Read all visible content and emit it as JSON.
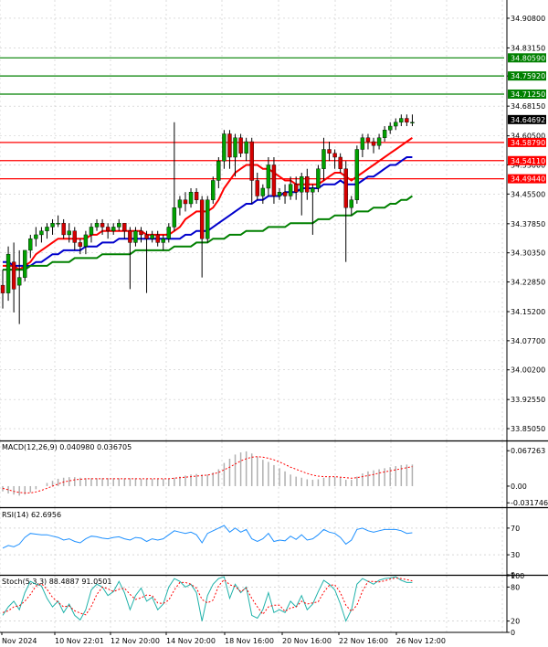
{
  "chart_data": {
    "type": "candlestick",
    "price_axis": {
      "ticks": [
        "34.90800",
        "34.83150",
        "34.75920",
        "34.68150",
        "34.60500",
        "34.53000",
        "34.45500",
        "34.37850",
        "34.30350",
        "34.22850",
        "34.15200",
        "34.07700",
        "34.00200",
        "33.92550",
        "33.85050"
      ],
      "tick_values": [
        34.908,
        34.8315,
        34.7592,
        34.6815,
        34.605,
        34.53,
        34.455,
        34.3785,
        34.3035,
        34.2285,
        34.152,
        34.077,
        34.002,
        33.9255,
        33.8505
      ],
      "range": [
        33.82,
        34.955
      ]
    },
    "price_tags": [
      {
        "label": "34.80590",
        "value": 34.8059,
        "color": "#008000"
      },
      {
        "label": "34.75920",
        "value": 34.7592,
        "color": "#008000"
      },
      {
        "label": "34.71250",
        "value": 34.7125,
        "color": "#008000"
      },
      {
        "label": "34.64692",
        "value": 34.64692,
        "color": "#000000"
      },
      {
        "label": "34.58790",
        "value": 34.5879,
        "color": "#ff0000"
      },
      {
        "label": "34.54110",
        "value": 34.5411,
        "color": "#ff0000"
      },
      {
        "label": "34.49440",
        "value": 34.4944,
        "color": "#ff0000"
      }
    ],
    "levels": {
      "resistance": [
        34.8059,
        34.7592,
        34.7125
      ],
      "support": [
        34.5879,
        34.5411,
        34.4944
      ]
    },
    "x_labels": [
      "Nov 2024",
      "10 Nov 22:01",
      "12 Nov 20:00",
      "14 Nov 20:00",
      "18 Nov 16:00",
      "20 Nov 16:00",
      "22 Nov 16:00",
      "26 Nov 12:00"
    ],
    "candles": [
      [
        34.22,
        34.26,
        34.16,
        34.2
      ],
      [
        34.2,
        34.32,
        34.18,
        34.3
      ],
      [
        34.28,
        34.33,
        34.15,
        34.21
      ],
      [
        34.22,
        34.31,
        34.12,
        34.24
      ],
      [
        34.24,
        34.31,
        34.23,
        34.31
      ],
      [
        34.31,
        34.35,
        34.29,
        34.34
      ],
      [
        34.34,
        34.37,
        34.32,
        34.35
      ],
      [
        34.35,
        34.37,
        34.33,
        34.36
      ],
      [
        34.36,
        34.38,
        34.34,
        34.37
      ],
      [
        34.37,
        34.39,
        34.35,
        34.38
      ],
      [
        34.38,
        34.4,
        34.37,
        34.38
      ],
      [
        34.38,
        34.39,
        34.34,
        34.35
      ],
      [
        34.35,
        34.38,
        34.33,
        34.36
      ],
      [
        34.36,
        34.37,
        34.31,
        34.33
      ],
      [
        34.33,
        34.34,
        34.3,
        34.32
      ],
      [
        34.32,
        34.36,
        34.3,
        34.35
      ],
      [
        34.35,
        34.38,
        34.33,
        34.37
      ],
      [
        34.37,
        34.39,
        34.36,
        34.38
      ],
      [
        34.38,
        34.39,
        34.35,
        34.37
      ],
      [
        34.37,
        34.38,
        34.34,
        34.36
      ],
      [
        34.36,
        34.38,
        34.35,
        34.37
      ],
      [
        34.37,
        34.39,
        34.36,
        34.38
      ],
      [
        34.38,
        34.38,
        34.34,
        34.36
      ],
      [
        34.36,
        34.37,
        34.21,
        34.33
      ],
      [
        34.33,
        34.37,
        34.32,
        34.36
      ],
      [
        34.36,
        34.37,
        34.33,
        34.35
      ],
      [
        34.35,
        34.36,
        34.2,
        34.34
      ],
      [
        34.34,
        34.36,
        34.33,
        34.35
      ],
      [
        34.35,
        34.36,
        34.32,
        34.33
      ],
      [
        34.33,
        34.35,
        34.31,
        34.34
      ],
      [
        34.34,
        34.38,
        34.33,
        34.37
      ],
      [
        34.37,
        34.64,
        34.36,
        34.42
      ],
      [
        34.42,
        34.45,
        34.4,
        34.44
      ],
      [
        34.44,
        34.46,
        34.41,
        34.43
      ],
      [
        34.43,
        34.47,
        34.42,
        34.46
      ],
      [
        34.46,
        34.47,
        34.43,
        34.44
      ],
      [
        34.44,
        34.45,
        34.24,
        34.34
      ],
      [
        34.34,
        34.45,
        34.33,
        34.44
      ],
      [
        34.44,
        34.5,
        34.43,
        34.49
      ],
      [
        34.49,
        34.55,
        34.47,
        34.54
      ],
      [
        34.54,
        34.62,
        34.52,
        34.61
      ],
      [
        34.61,
        34.62,
        34.52,
        34.55
      ],
      [
        34.55,
        34.61,
        34.5,
        34.6
      ],
      [
        34.6,
        34.61,
        34.55,
        34.56
      ],
      [
        34.56,
        34.6,
        34.54,
        34.59
      ],
      [
        34.59,
        34.6,
        34.43,
        34.49
      ],
      [
        34.49,
        34.51,
        34.44,
        34.45
      ],
      [
        34.45,
        34.48,
        34.43,
        34.47
      ],
      [
        34.47,
        34.55,
        34.45,
        34.53
      ],
      [
        34.53,
        34.55,
        34.43,
        34.45
      ],
      [
        34.45,
        34.47,
        34.44,
        34.46
      ],
      [
        34.46,
        34.48,
        34.43,
        34.45
      ],
      [
        34.45,
        34.5,
        34.44,
        34.48
      ],
      [
        34.48,
        34.5,
        34.44,
        34.46
      ],
      [
        34.46,
        34.51,
        34.4,
        34.5
      ],
      [
        34.5,
        34.52,
        34.44,
        34.46
      ],
      [
        34.46,
        34.48,
        34.35,
        34.47
      ],
      [
        34.47,
        34.53,
        34.46,
        34.52
      ],
      [
        34.52,
        34.6,
        34.49,
        34.57
      ],
      [
        34.57,
        34.59,
        34.54,
        34.56
      ],
      [
        34.56,
        34.57,
        34.52,
        34.55
      ],
      [
        34.55,
        34.56,
        34.51,
        34.52
      ],
      [
        34.52,
        34.54,
        34.28,
        34.42
      ],
      [
        34.42,
        34.45,
        34.4,
        34.44
      ],
      [
        34.44,
        34.58,
        34.43,
        34.57
      ],
      [
        34.57,
        34.61,
        34.55,
        34.6
      ],
      [
        34.6,
        34.61,
        34.57,
        34.59
      ],
      [
        34.59,
        34.6,
        34.56,
        34.58
      ],
      [
        34.58,
        34.61,
        34.57,
        34.6
      ],
      [
        34.6,
        34.63,
        34.59,
        34.62
      ],
      [
        34.62,
        34.64,
        34.61,
        34.63
      ],
      [
        34.63,
        34.65,
        34.62,
        34.64
      ],
      [
        34.64,
        34.66,
        34.63,
        34.65
      ],
      [
        34.65,
        34.66,
        34.63,
        34.64
      ],
      [
        34.64,
        34.66,
        34.63,
        34.64
      ]
    ],
    "moving_averages": [
      {
        "color": "#ff0000",
        "values": [
          34.27,
          34.27,
          34.27,
          34.26,
          34.27,
          34.28,
          34.3,
          34.31,
          34.32,
          34.33,
          34.34,
          34.34,
          34.34,
          34.34,
          34.34,
          34.34,
          34.35,
          34.35,
          34.36,
          34.36,
          34.36,
          34.36,
          34.36,
          34.36,
          34.36,
          34.36,
          34.35,
          34.35,
          34.35,
          34.35,
          34.35,
          34.36,
          34.37,
          34.39,
          34.4,
          34.41,
          34.41,
          34.41,
          34.42,
          34.44,
          34.47,
          34.49,
          34.51,
          34.52,
          34.53,
          34.53,
          34.53,
          34.52,
          34.52,
          34.51,
          34.5,
          34.49,
          34.49,
          34.48,
          34.48,
          34.48,
          34.48,
          34.48,
          34.49,
          34.5,
          34.51,
          34.51,
          34.5,
          34.49,
          34.5,
          34.51,
          34.52,
          34.53,
          34.54,
          34.55,
          34.56,
          34.57,
          34.58,
          34.59,
          34.6
        ]
      },
      {
        "color": "#0000cc",
        "values": [
          34.28,
          34.28,
          34.27,
          34.27,
          34.27,
          34.27,
          34.28,
          34.28,
          34.29,
          34.3,
          34.3,
          34.31,
          34.31,
          34.31,
          34.31,
          34.32,
          34.32,
          34.32,
          34.33,
          34.33,
          34.33,
          34.34,
          34.34,
          34.34,
          34.34,
          34.34,
          34.34,
          34.34,
          34.34,
          34.34,
          34.34,
          34.34,
          34.34,
          34.35,
          34.35,
          34.36,
          34.36,
          34.36,
          34.37,
          34.38,
          34.39,
          34.4,
          34.41,
          34.42,
          34.43,
          34.43,
          34.44,
          34.44,
          34.45,
          34.45,
          34.45,
          34.46,
          34.46,
          34.46,
          34.47,
          34.47,
          34.47,
          34.47,
          34.48,
          34.48,
          34.48,
          34.49,
          34.48,
          34.48,
          34.48,
          34.49,
          34.5,
          34.5,
          34.51,
          34.52,
          34.53,
          34.53,
          34.54,
          34.55,
          34.55
        ]
      },
      {
        "color": "#008000",
        "values": [
          34.26,
          34.26,
          34.26,
          34.26,
          34.26,
          34.27,
          34.27,
          34.27,
          34.27,
          34.28,
          34.28,
          34.28,
          34.28,
          34.29,
          34.29,
          34.29,
          34.29,
          34.29,
          34.3,
          34.3,
          34.3,
          34.3,
          34.3,
          34.3,
          34.31,
          34.31,
          34.31,
          34.31,
          34.31,
          34.31,
          34.31,
          34.32,
          34.32,
          34.32,
          34.32,
          34.33,
          34.33,
          34.33,
          34.34,
          34.34,
          34.34,
          34.35,
          34.35,
          34.35,
          34.36,
          34.36,
          34.36,
          34.36,
          34.37,
          34.37,
          34.37,
          34.37,
          34.38,
          34.38,
          34.38,
          34.38,
          34.38,
          34.39,
          34.39,
          34.39,
          34.4,
          34.4,
          34.4,
          34.4,
          34.41,
          34.41,
          34.41,
          34.42,
          34.42,
          34.42,
          34.43,
          34.43,
          34.44,
          34.44,
          34.45
        ]
      }
    ],
    "macd": {
      "label": "MACD(12,26,9) 0.040980 0.036705",
      "ticks": [
        "0.067263",
        "0.00",
        "-0.031746"
      ],
      "tick_values": [
        0.067263,
        0.0,
        -0.031746
      ],
      "range": [
        -0.04,
        0.085
      ],
      "histogram": [
        -0.01,
        -0.014,
        -0.016,
        -0.018,
        -0.016,
        -0.012,
        -0.006,
        0.0,
        0.006,
        0.01,
        0.014,
        0.016,
        0.017,
        0.017,
        0.016,
        0.015,
        0.015,
        0.015,
        0.015,
        0.015,
        0.015,
        0.015,
        0.015,
        0.015,
        0.015,
        0.014,
        0.014,
        0.014,
        0.014,
        0.014,
        0.014,
        0.016,
        0.018,
        0.02,
        0.022,
        0.023,
        0.022,
        0.022,
        0.026,
        0.032,
        0.044,
        0.052,
        0.06,
        0.064,
        0.066,
        0.062,
        0.056,
        0.05,
        0.046,
        0.04,
        0.034,
        0.028,
        0.022,
        0.018,
        0.016,
        0.013,
        0.012,
        0.013,
        0.016,
        0.018,
        0.018,
        0.016,
        0.012,
        0.012,
        0.018,
        0.024,
        0.028,
        0.03,
        0.032,
        0.034,
        0.036,
        0.038,
        0.04,
        0.041,
        0.041
      ],
      "signal": [
        -0.004,
        -0.007,
        -0.01,
        -0.012,
        -0.013,
        -0.013,
        -0.011,
        -0.008,
        -0.004,
        0.0,
        0.004,
        0.008,
        0.01,
        0.012,
        0.013,
        0.014,
        0.014,
        0.014,
        0.014,
        0.014,
        0.014,
        0.014,
        0.014,
        0.014,
        0.014,
        0.014,
        0.014,
        0.014,
        0.014,
        0.014,
        0.014,
        0.015,
        0.016,
        0.017,
        0.018,
        0.019,
        0.02,
        0.021,
        0.023,
        0.026,
        0.031,
        0.036,
        0.042,
        0.048,
        0.052,
        0.055,
        0.056,
        0.055,
        0.053,
        0.05,
        0.046,
        0.041,
        0.036,
        0.032,
        0.028,
        0.024,
        0.021,
        0.019,
        0.018,
        0.018,
        0.018,
        0.017,
        0.016,
        0.015,
        0.016,
        0.018,
        0.02,
        0.022,
        0.025,
        0.027,
        0.029,
        0.031,
        0.033,
        0.035,
        0.037
      ]
    },
    "rsi": {
      "label": "RSI(14) 62.6956",
      "ticks": [
        "70",
        "30",
        "0"
      ],
      "tick_values": [
        70,
        30,
        0
      ],
      "range": [
        0,
        100
      ],
      "values": [
        40,
        44,
        42,
        46,
        56,
        62,
        61,
        60,
        60,
        58,
        56,
        52,
        54,
        50,
        48,
        54,
        58,
        57,
        55,
        54,
        56,
        57,
        54,
        52,
        56,
        55,
        50,
        54,
        52,
        54,
        60,
        66,
        64,
        62,
        64,
        60,
        48,
        62,
        66,
        70,
        74,
        64,
        70,
        64,
        68,
        54,
        50,
        54,
        62,
        50,
        52,
        51,
        58,
        53,
        60,
        52,
        54,
        60,
        68,
        64,
        62,
        56,
        46,
        52,
        68,
        70,
        66,
        64,
        66,
        68,
        68,
        68,
        66,
        62,
        63
      ]
    },
    "stoch": {
      "label": "Stoch(5,3,3) 88.4887 91.0501",
      "ticks": [
        "100",
        "80",
        "20",
        "0"
      ],
      "tick_values": [
        100,
        80,
        20,
        0
      ],
      "range": [
        0,
        100
      ],
      "k": [
        30,
        45,
        55,
        40,
        70,
        90,
        85,
        82,
        60,
        45,
        55,
        35,
        50,
        30,
        22,
        40,
        75,
        85,
        80,
        65,
        72,
        90,
        70,
        40,
        65,
        78,
        55,
        62,
        40,
        50,
        80,
        95,
        90,
        80,
        85,
        70,
        20,
        65,
        85,
        95,
        98,
        60,
        85,
        70,
        80,
        30,
        25,
        40,
        70,
        35,
        40,
        35,
        55,
        45,
        65,
        40,
        50,
        72,
        92,
        85,
        75,
        50,
        20,
        40,
        85,
        95,
        90,
        85,
        92,
        95,
        96,
        98,
        92,
        88,
        88
      ],
      "d": [
        35,
        38,
        45,
        47,
        55,
        67,
        82,
        86,
        76,
        62,
        53,
        45,
        47,
        38,
        34,
        31,
        46,
        67,
        80,
        77,
        72,
        76,
        78,
        67,
        58,
        61,
        66,
        65,
        52,
        51,
        57,
        75,
        88,
        88,
        85,
        78,
        58,
        52,
        57,
        82,
        93,
        84,
        81,
        72,
        78,
        60,
        45,
        32,
        45,
        48,
        48,
        37,
        43,
        45,
        55,
        50,
        52,
        54,
        71,
        83,
        84,
        70,
        48,
        37,
        48,
        73,
        90,
        90,
        89,
        91,
        94,
        96,
        95,
        93,
        91
      ]
    }
  }
}
